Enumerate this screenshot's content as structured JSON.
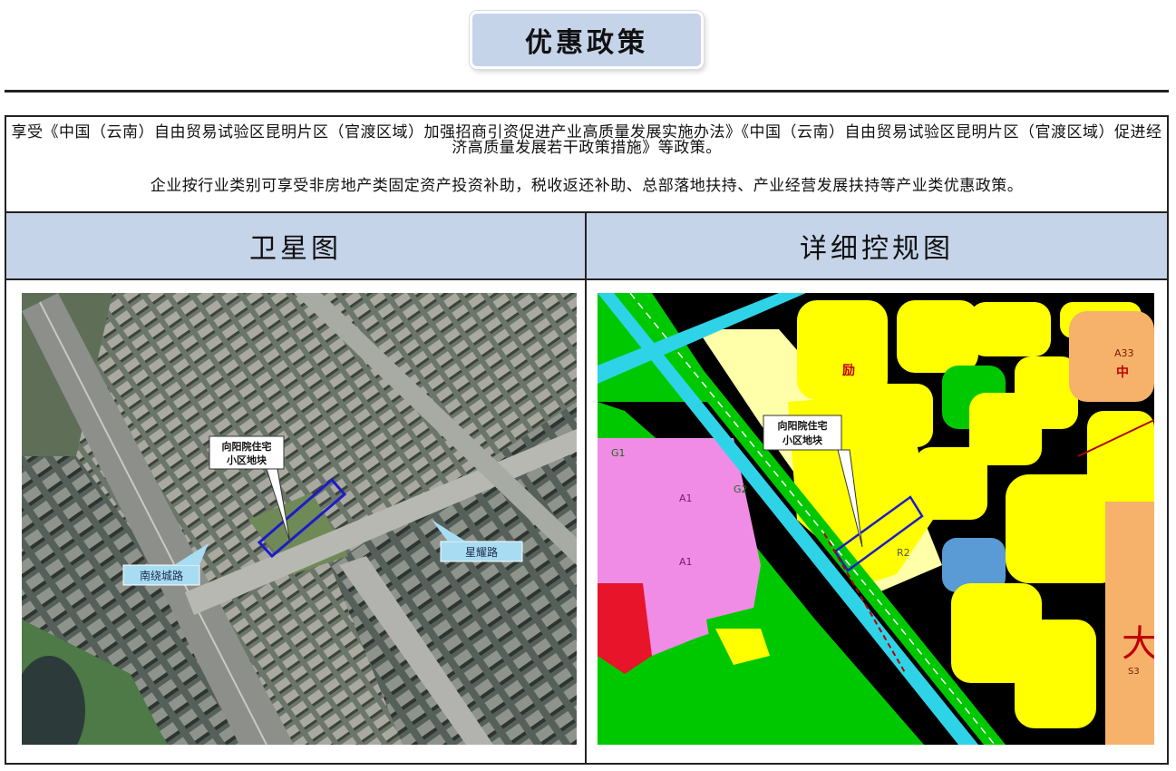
{
  "header": {
    "title": "优惠政策"
  },
  "intro": {
    "line1": "享受《中国（云南）自由贸易试验区昆明片区（官渡区域）加强招商引资促进产业高质量发展实施办法》《中国（云南）自由贸易试验区昆明片区（官渡区域）促进经济高质量发展若干政策措施》等政策。",
    "line2": "企业按行业类别可享受非房地产类固定资产投资补助，税收返还补助、总部落地扶持、产业经营发展扶持等产业类优惠政策。"
  },
  "columns": {
    "left_title": "卫星图",
    "right_title": "详细控规图"
  },
  "satellite": {
    "site_label_line1": "向阳院住宅",
    "site_label_line2": "小区地块",
    "road_label_1": "南绕城路",
    "road_label_2": "星耀路"
  },
  "plan": {
    "site_label_line1": "向阳院住宅",
    "site_label_line2": "小区地块",
    "big_char": "大",
    "zone_codes": [
      "A1",
      "A1",
      "G1",
      "G2",
      "R2",
      "A33",
      "中",
      "励",
      "S3"
    ]
  },
  "colors": {
    "title_bg": "#c6d4ea",
    "header_bg": "#c6d4ea",
    "residential_yellow": "#ffff00",
    "green_space": "#00c800",
    "road_cyan": "#2fd3e8",
    "admin_pink": "#f08ce6",
    "plot_boundary": "#1c1cc8"
  }
}
